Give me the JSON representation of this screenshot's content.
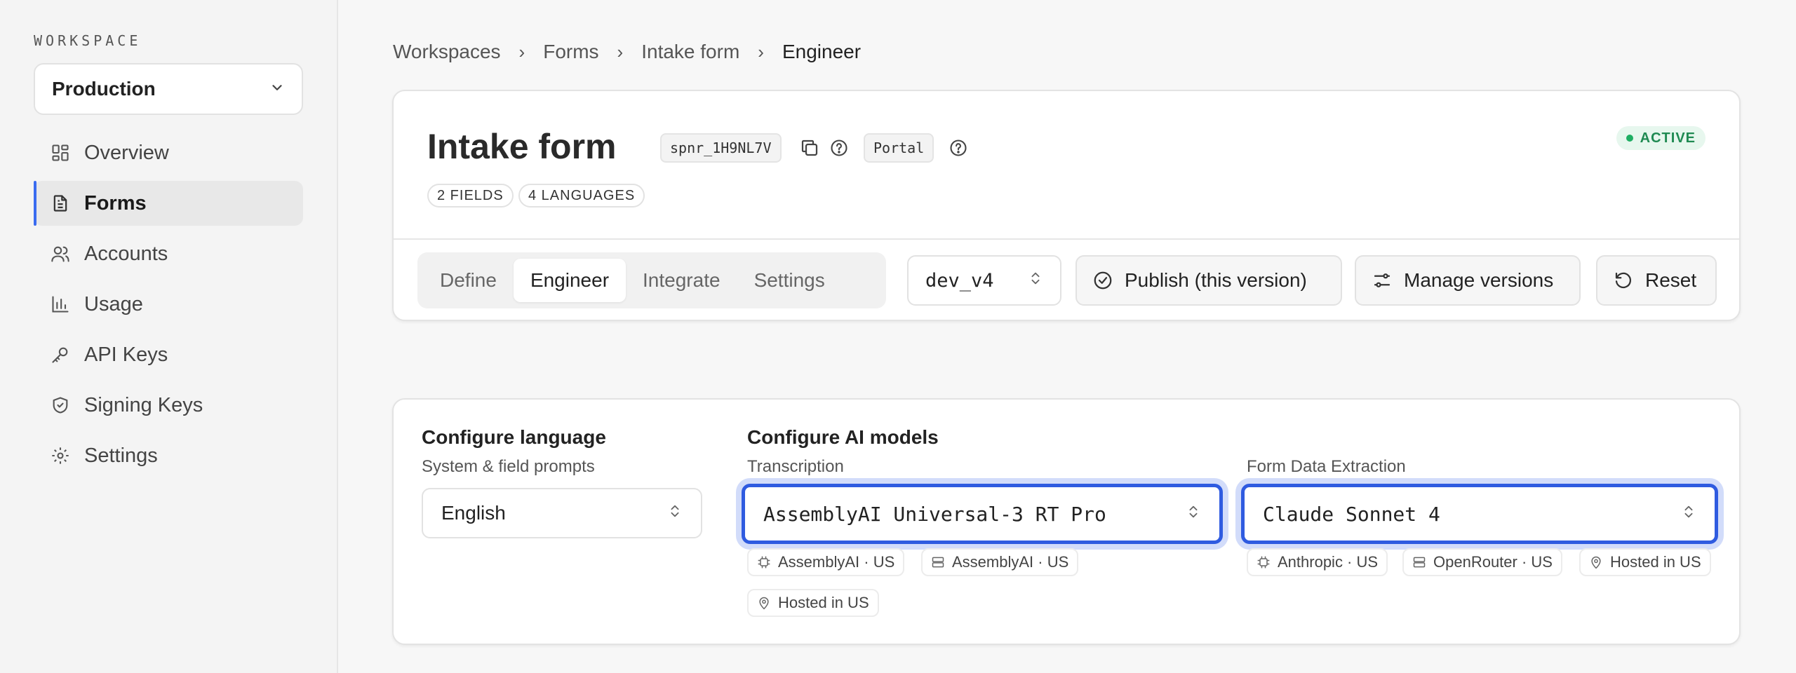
{
  "sidebar": {
    "workspace_label": "WORKSPACE",
    "workspace_value": "Production",
    "items": [
      {
        "label": "Overview",
        "icon": "grid-icon"
      },
      {
        "label": "Forms",
        "icon": "document-icon",
        "active": true
      },
      {
        "label": "Accounts",
        "icon": "users-icon"
      },
      {
        "label": "Usage",
        "icon": "bar-chart-icon"
      },
      {
        "label": "API Keys",
        "icon": "key-icon"
      },
      {
        "label": "Signing Keys",
        "icon": "shield-check-icon"
      },
      {
        "label": "Settings",
        "icon": "gear-icon"
      }
    ]
  },
  "breadcrumb": [
    "Workspaces",
    "Forms",
    "Intake form",
    "Engineer"
  ],
  "header": {
    "title": "Intake form",
    "id_chip": "spnr_1H9NL7V",
    "portal_chip": "Portal",
    "status": "ACTIVE",
    "badges": [
      "2 FIELDS",
      "4 LANGUAGES"
    ],
    "tabs": [
      "Define",
      "Engineer",
      "Integrate",
      "Settings"
    ],
    "active_tab": "Engineer",
    "version": "dev_v4",
    "publish_label": "Publish (this version)",
    "manage_label": "Manage versions",
    "reset_label": "Reset"
  },
  "config": {
    "language": {
      "title": "Configure language",
      "subtitle": "System & field prompts",
      "value": "English"
    },
    "models": {
      "title": "Configure AI models",
      "transcription": {
        "label": "Transcription",
        "value": "AssemblyAI Universal-3 RT Pro",
        "tags": [
          "AssemblyAI · US",
          "AssemblyAI · US",
          "Hosted in US"
        ]
      },
      "extraction": {
        "label": "Form Data Extraction",
        "value": "Claude Sonnet 4",
        "tags": [
          "Anthropic · US",
          "OpenRouter · US",
          "Hosted in US"
        ]
      }
    }
  },
  "colors": {
    "accent": "#2f5be0",
    "active_green": "#1f8a52"
  }
}
